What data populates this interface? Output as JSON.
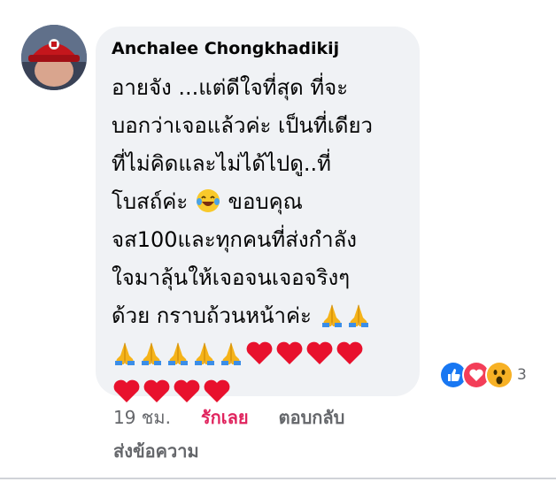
{
  "comment": {
    "author": "Anchalee Chongkhadikij",
    "lines": [
      "อายจัง ...แต่ดีใจที่สุด ที่จะ",
      "บอกว่าเจอแล้วค่ะ เป็นที่เดียว",
      "ที่ไม่คิดและไม่ได้ไปดู..ที่",
      "โบสถ์ค่ะ",
      "ขอบคุณ",
      "จส100และทุกคนที่ส่งกำลัง",
      "ใจมาลุ้นให้เจอจนเจอจริงๆ",
      "ด้วย กราบถ้วนหน้าค่ะ"
    ],
    "emoji": {
      "laugh": "laughing-tears-emoji",
      "pray": "folded-hands-emoji",
      "heart": "red-heart-emoji"
    }
  },
  "reactions": {
    "types": [
      "like",
      "love",
      "wow"
    ],
    "count": "3",
    "colors": {
      "like": "#1877f2",
      "love": "#f33e58",
      "wow": "#f7b125"
    }
  },
  "actions": {
    "time": "19 ชม.",
    "love": "รักเลย",
    "reply": "ตอบกลับ",
    "send_message": "ส่งข้อความ"
  }
}
